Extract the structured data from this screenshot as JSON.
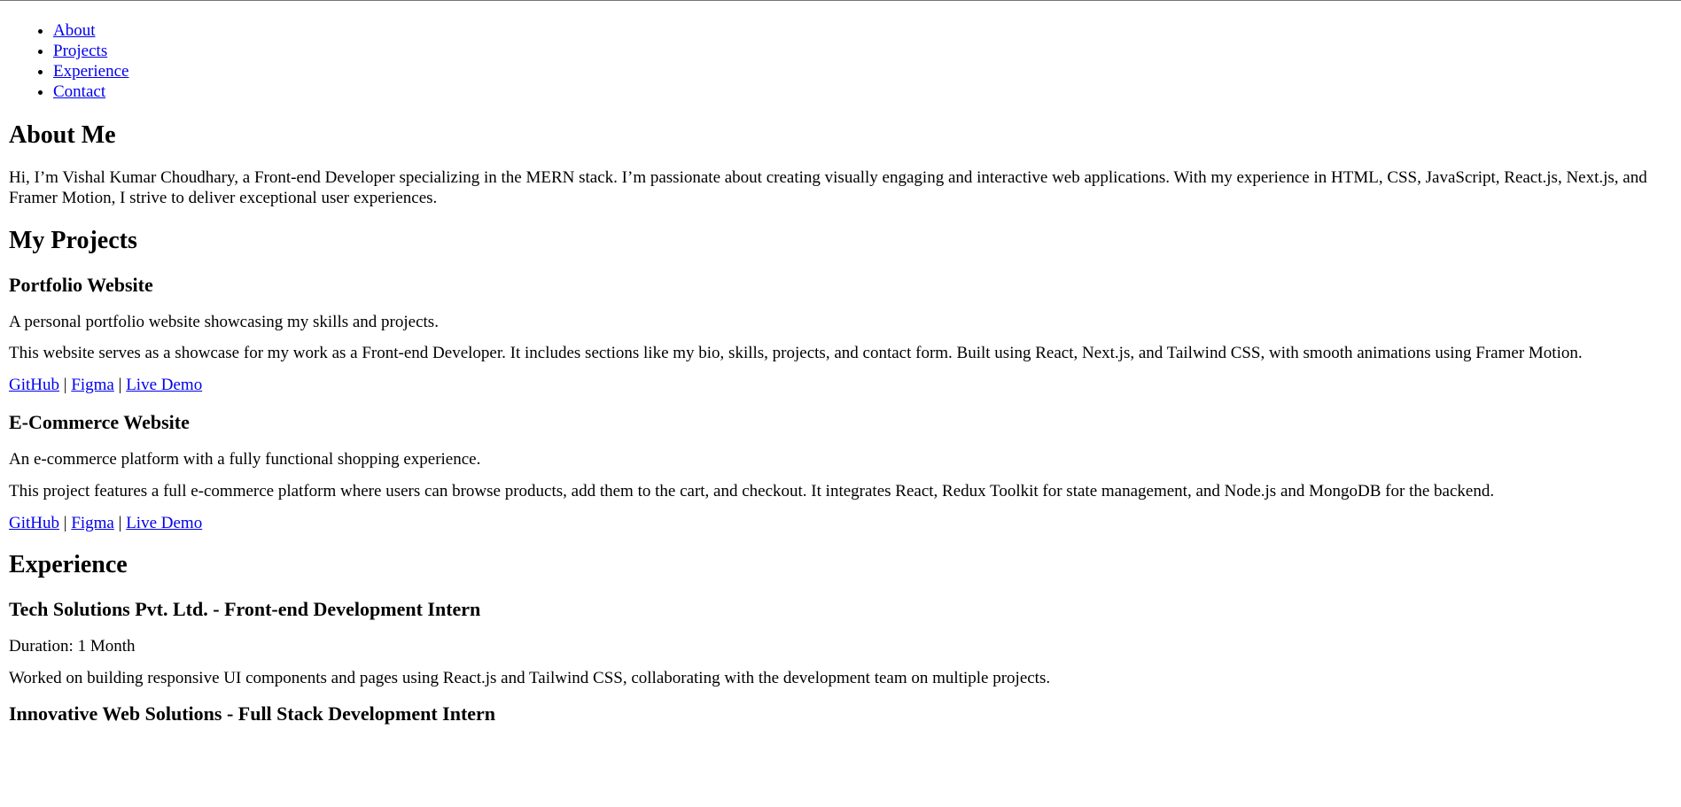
{
  "nav": {
    "items": [
      {
        "label": "About"
      },
      {
        "label": "Projects"
      },
      {
        "label": "Experience"
      },
      {
        "label": "Contact"
      }
    ]
  },
  "about": {
    "heading": "About Me",
    "text": "Hi, I’m Vishal Kumar Choudhary, a Front-end Developer specializing in the MERN stack. I’m passionate about creating visually engaging and interactive web applications. With my experience in HTML, CSS, JavaScript, React.js, Next.js, and Framer Motion, I strive to deliver exceptional user experiences."
  },
  "projects": {
    "heading": "My Projects",
    "separator": "|",
    "items": [
      {
        "title": "Portfolio Website",
        "summary": "A personal portfolio website showcasing my skills and projects.",
        "description": "This website serves as a showcase for my work as a Front-end Developer. It includes sections like my bio, skills, projects, and contact form. Built using React, Next.js, and Tailwind CSS, with smooth animations using Framer Motion.",
        "links": {
          "github": "GitHub",
          "figma": "Figma",
          "demo": "Live Demo"
        }
      },
      {
        "title": "E-Commerce Website",
        "summary": "An e-commerce platform with a fully functional shopping experience.",
        "description": "This project features a full e-commerce platform where users can browse products, add them to the cart, and checkout. It integrates React, Redux Toolkit for state management, and Node.js and MongoDB for the backend.",
        "links": {
          "github": "GitHub",
          "figma": "Figma",
          "demo": "Live Demo"
        }
      }
    ]
  },
  "experience": {
    "heading": "Experience",
    "items": [
      {
        "title": "Tech Solutions Pvt. Ltd. - Front-end Development Intern",
        "duration": "Duration: 1 Month",
        "description": "Worked on building responsive UI components and pages using React.js and Tailwind CSS, collaborating with the development team on multiple projects."
      },
      {
        "title": "Innovative Web Solutions - Full Stack Development Intern"
      }
    ]
  },
  "colors": {
    "link": "#0000EE",
    "text": "#000000",
    "background": "#ffffff"
  }
}
